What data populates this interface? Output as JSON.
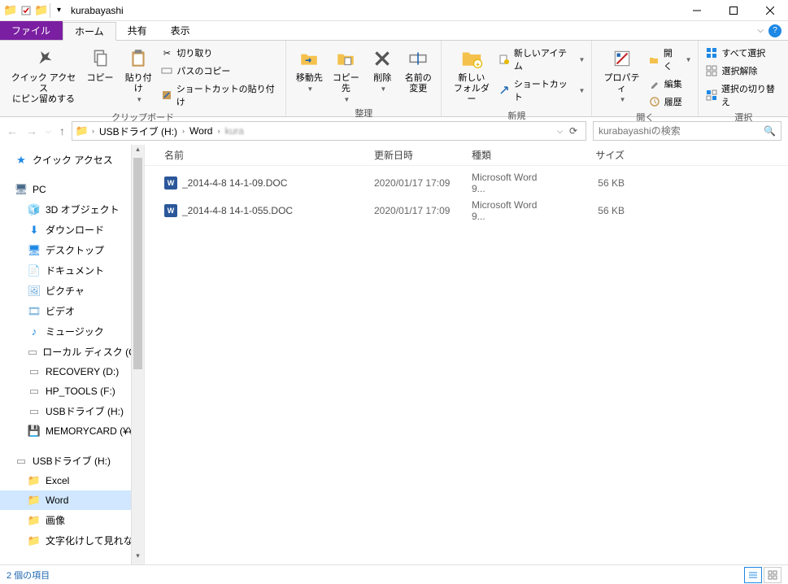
{
  "window": {
    "title": "kurabayashi"
  },
  "tabs": {
    "file": "ファイル",
    "home": "ホーム",
    "share": "共有",
    "view": "表示"
  },
  "ribbon": {
    "clipboard": {
      "label": "クリップボード",
      "pin": "クイック アクセス\nにピン留めする",
      "copy": "コピー",
      "paste": "貼り付け",
      "cut": "切り取り",
      "copy_path": "パスのコピー",
      "paste_shortcut": "ショートカットの貼り付け"
    },
    "organize": {
      "label": "整理",
      "move": "移動先",
      "copy_to": "コピー先",
      "delete": "削除",
      "rename": "名前の\n変更"
    },
    "new": {
      "label": "新規",
      "new_folder": "新しい\nフォルダー",
      "new_item": "新しいアイテム",
      "shortcut": "ショートカット"
    },
    "open": {
      "label": "開く",
      "properties": "プロパティ",
      "open_btn": "開く",
      "edit": "編集",
      "history": "履歴"
    },
    "select": {
      "label": "選択",
      "select_all": "すべて選択",
      "select_none": "選択解除",
      "invert": "選択の切り替え"
    }
  },
  "breadcrumb": {
    "items": [
      "USBドライブ (H:)",
      "Word",
      ""
    ],
    "refresh_title": "更新"
  },
  "search": {
    "placeholder": "kurabayashiの検索"
  },
  "columns": {
    "name": "名前",
    "date": "更新日時",
    "type": "種類",
    "size": "サイズ"
  },
  "nav": {
    "quick_access": "クイック アクセス",
    "pc": "PC",
    "pc_children": [
      {
        "label": "3D オブジェクト",
        "icon": "cube",
        "color": "#1e88e5"
      },
      {
        "label": "ダウンロード",
        "icon": "download",
        "color": "#1e88e5"
      },
      {
        "label": "デスクトップ",
        "icon": "desktop",
        "color": "#1e88e5"
      },
      {
        "label": "ドキュメント",
        "icon": "doc",
        "color": "#6aa9d8"
      },
      {
        "label": "ピクチャ",
        "icon": "picture",
        "color": "#6aa9d8"
      },
      {
        "label": "ビデオ",
        "icon": "video",
        "color": "#6aa9d8"
      },
      {
        "label": "ミュージック",
        "icon": "music",
        "color": "#1e88e5"
      },
      {
        "label": "ローカル ディスク (C:)",
        "icon": "drive",
        "color": "#888"
      },
      {
        "label": "RECOVERY (D:)",
        "icon": "drive",
        "color": "#888"
      },
      {
        "label": "HP_TOOLS (F:)",
        "icon": "drive",
        "color": "#888"
      },
      {
        "label": "USBドライブ (H:)",
        "icon": "drive",
        "color": "#888"
      },
      {
        "label": "MEMORYCARD (¥¥",
        "icon": "sd",
        "color": "#c62828"
      }
    ],
    "usb": "USBドライブ (H:)",
    "usb_children": [
      {
        "label": "Excel"
      },
      {
        "label": "Word",
        "selected": true
      },
      {
        "label": "画像"
      },
      {
        "label": "文字化けして見れない"
      }
    ]
  },
  "files": [
    {
      "name": "_2014-4-8 14-1-09.DOC",
      "date": "2020/01/17 17:09",
      "type": "Microsoft Word 9...",
      "size": "56 KB"
    },
    {
      "name": "_2014-4-8 14-1-055.DOC",
      "date": "2020/01/17 17:09",
      "type": "Microsoft Word 9...",
      "size": "56 KB"
    }
  ],
  "status": {
    "item_count": "2 個の項目"
  }
}
